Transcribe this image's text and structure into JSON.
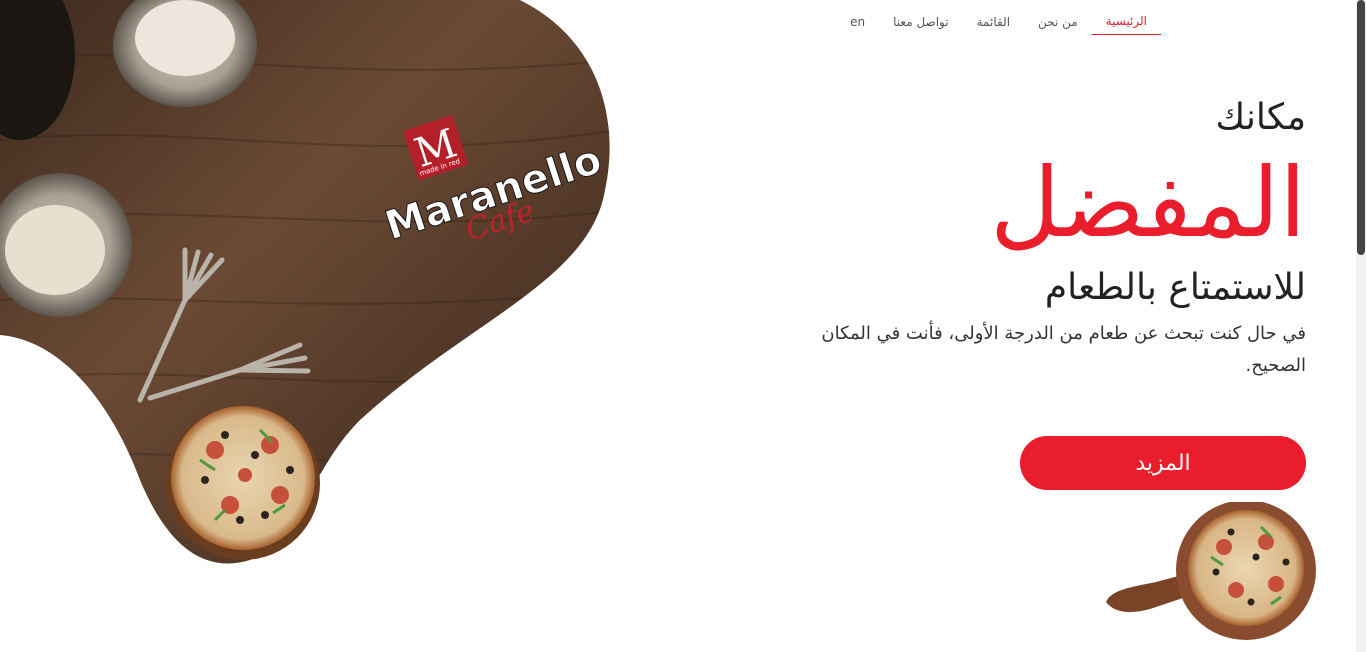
{
  "nav": {
    "items": [
      {
        "label": "الرئيسية",
        "active": true
      },
      {
        "label": "من نحن",
        "active": false
      },
      {
        "label": "القائمة",
        "active": false
      },
      {
        "label": "تواصل معنا",
        "active": false
      },
      {
        "label": "en",
        "active": false
      }
    ]
  },
  "hero": {
    "kicker": "مكانك",
    "headline": "المفضل",
    "subhead": "للاستمتاع بالطعام",
    "description": "في حال كنت تبحث عن طعام من الدرجة الأولى، فأنت في المكان الصحيح.",
    "button_label": "المزيد"
  },
  "logo": {
    "letter": "M",
    "tagline": "made in red",
    "brand": "Maranello",
    "script": "Cafe"
  },
  "colors": {
    "accent": "#ea1d2c",
    "wood": "#5b3f2c",
    "text": "#222222"
  }
}
